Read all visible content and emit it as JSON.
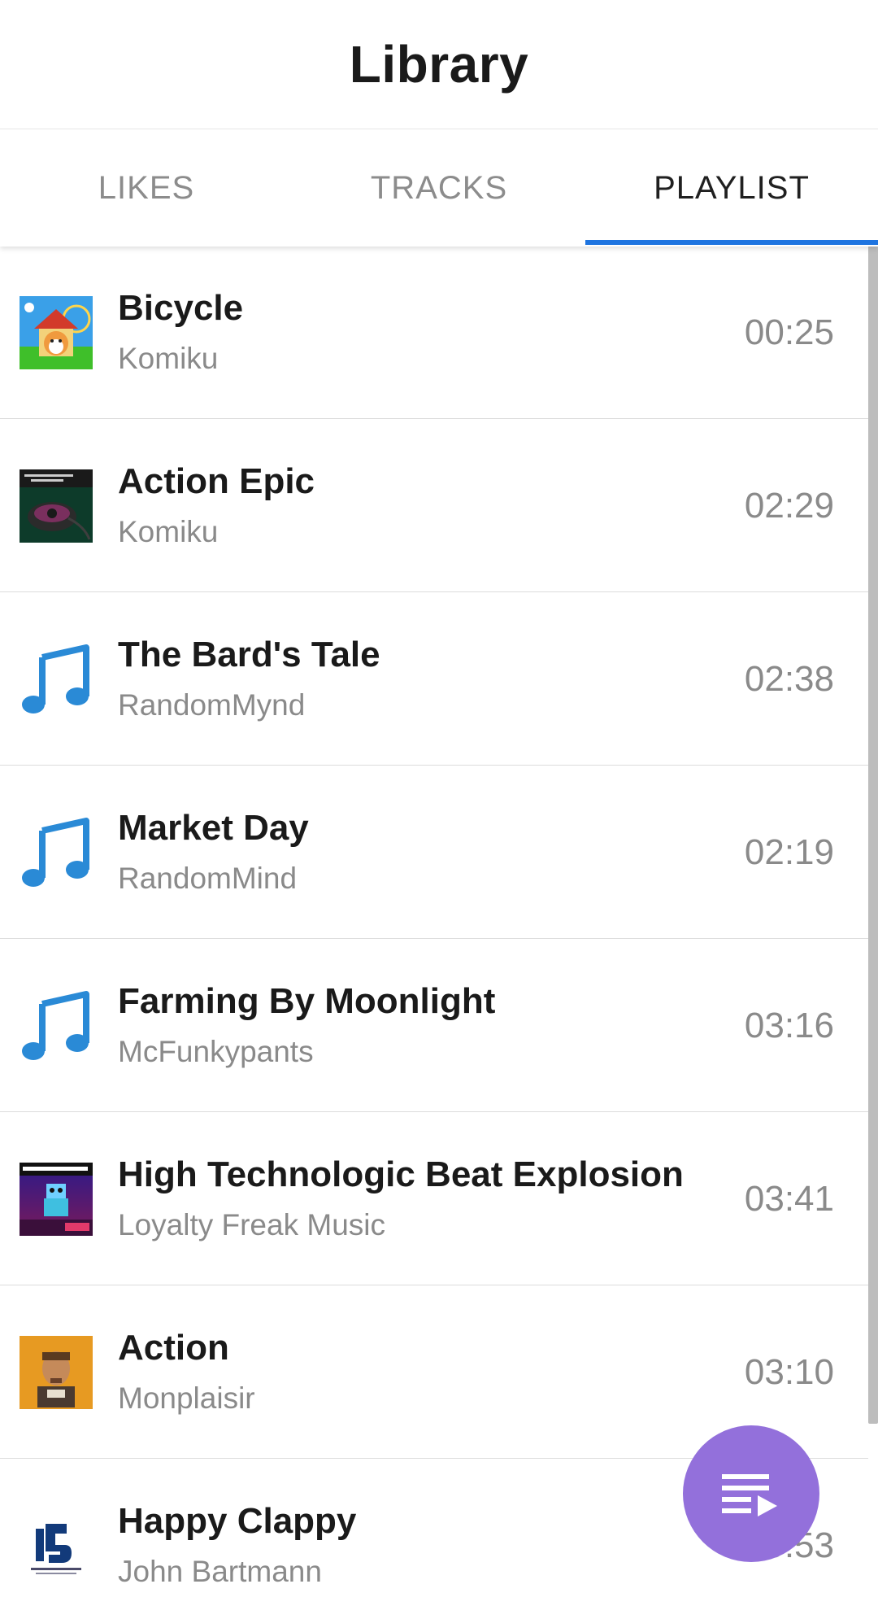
{
  "header": {
    "title": "Library"
  },
  "tabs": [
    {
      "label": "LIKES"
    },
    {
      "label": "TRACKS"
    },
    {
      "label": "PLAYLIST",
      "active": true
    }
  ],
  "colors": {
    "accent": "#1e74e0",
    "fab": "#9370db",
    "note_icon": "#2a8ad6"
  },
  "tracks": [
    {
      "title": "Bicycle",
      "artist": "Komiku",
      "duration": "00:25",
      "art": "cover-art"
    },
    {
      "title": "Action Epic",
      "artist": "Komiku",
      "duration": "02:29",
      "art": "cover-art"
    },
    {
      "title": "The Bard's Tale",
      "artist": "RandomMynd",
      "duration": "02:38",
      "art": "music-note-icon"
    },
    {
      "title": "Market Day",
      "artist": "RandomMind",
      "duration": "02:19",
      "art": "music-note-icon"
    },
    {
      "title": "Farming By Moonlight",
      "artist": "McFunkypants",
      "duration": "03:16",
      "art": "music-note-icon"
    },
    {
      "title": "High Technologic Beat Explosion",
      "artist": "Loyalty Freak Music",
      "duration": "03:41",
      "art": "cover-art"
    },
    {
      "title": "Action",
      "artist": "Monplaisir",
      "duration": "03:10",
      "art": "cover-art"
    },
    {
      "title": "Happy Clappy",
      "artist": "John Bartmann",
      "duration": "00:53",
      "art": "cover-art"
    }
  ],
  "fab": {
    "icon": "queue-play-icon"
  }
}
